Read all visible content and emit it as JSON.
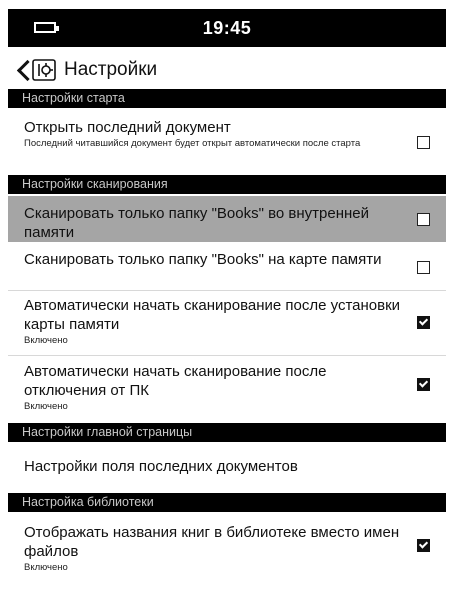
{
  "status_bar": {
    "time": "19:45",
    "battery_icon": "battery-icon"
  },
  "header": {
    "title": "Настройки",
    "back_icon": "chevron-left-icon",
    "app_icon": "settings-icon"
  },
  "sections": [
    {
      "title": "Настройки старта",
      "items": [
        {
          "label": "Открыть последний документ",
          "description": "Последний читавшийся документ будет открыт автоматически после старта",
          "checked": false
        }
      ]
    },
    {
      "title": "Настройки сканирования",
      "items": [
        {
          "label": "Сканировать только папку \"Books\" во внутренней памяти",
          "checked": false,
          "highlighted": true
        },
        {
          "label": "Сканировать только папку \"Books\" на карте памяти",
          "checked": false
        },
        {
          "label": "Автоматически начать сканирование после установки карты памяти",
          "description": "Включено",
          "checked": true
        },
        {
          "label": "Автоматически начать сканирование после отключения от ПК",
          "description": "Включено",
          "checked": true
        }
      ]
    },
    {
      "title": "Настройки главной страницы",
      "items": [
        {
          "label": "Настройки поля последних документов"
        }
      ]
    },
    {
      "title": "Настройка библиотеки",
      "items": [
        {
          "label": "Отображать названия книг в библиотеке вместо имен файлов",
          "description": "Включено",
          "checked": true
        }
      ]
    }
  ]
}
